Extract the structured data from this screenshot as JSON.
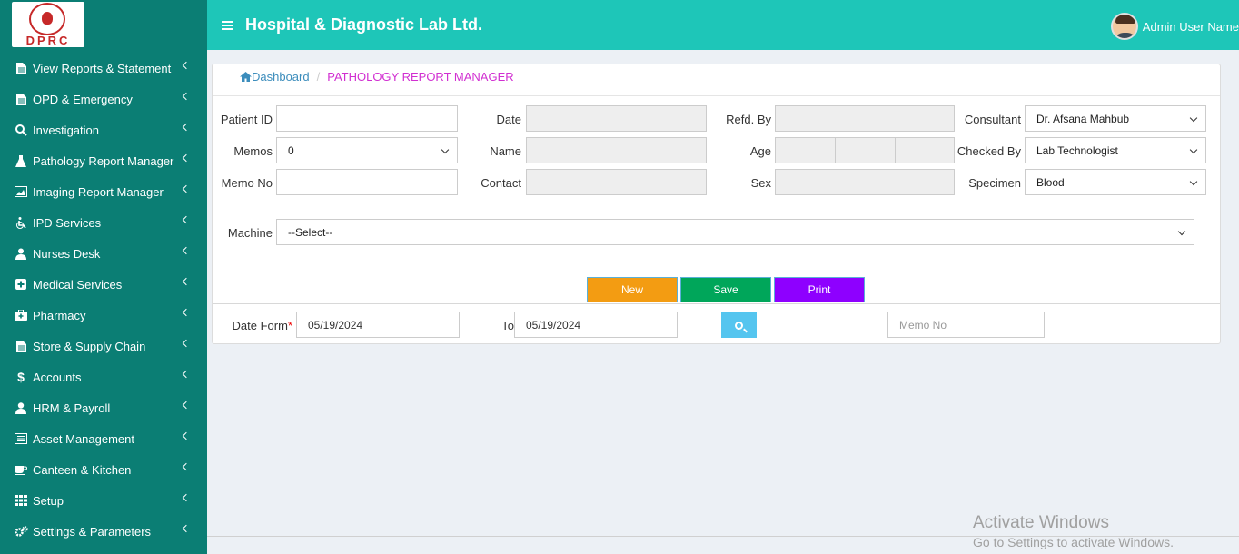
{
  "logo": {
    "text": "DPRC"
  },
  "header": {
    "title": "Hospital & Diagnostic Lab Ltd.",
    "user_name": "Admin User Name"
  },
  "sidebar": {
    "items": [
      {
        "label": "View Reports & Statement",
        "icon": "file-icon"
      },
      {
        "label": "OPD & Emergency",
        "icon": "file-icon"
      },
      {
        "label": "Investigation",
        "icon": "search-icon"
      },
      {
        "label": "Pathology Report Manager",
        "icon": "flask-icon"
      },
      {
        "label": "Imaging Report Manager",
        "icon": "image-icon"
      },
      {
        "label": "IPD Services",
        "icon": "wheelchair-icon"
      },
      {
        "label": "Nurses Desk",
        "icon": "user-md-icon"
      },
      {
        "label": "Medical Services",
        "icon": "plus-square-icon"
      },
      {
        "label": "Pharmacy",
        "icon": "medkit-icon"
      },
      {
        "label": "Store & Supply Chain",
        "icon": "file-icon"
      },
      {
        "label": "Accounts",
        "icon": "dollar-icon"
      },
      {
        "label": "HRM & Payroll",
        "icon": "user-icon"
      },
      {
        "label": "Asset Management",
        "icon": "list-icon"
      },
      {
        "label": "Canteen & Kitchen",
        "icon": "coffee-icon"
      },
      {
        "label": "Setup",
        "icon": "grid-icon"
      },
      {
        "label": "Settings & Parameters",
        "icon": "gears-icon"
      }
    ]
  },
  "breadcrumb": {
    "home": "Dashboard",
    "current": "PATHOLOGY REPORT MANAGER"
  },
  "form": {
    "patient_id_label": "Patient ID",
    "patient_id_value": "",
    "memos_label": "Memos",
    "memos_value": "0",
    "memo_no_label": "Memo No",
    "memo_no_value": "",
    "date_label": "Date",
    "name_label": "Name",
    "contact_label": "Contact",
    "refd_by_label": "Refd. By",
    "age_label": "Age",
    "sex_label": "Sex",
    "consultant_label": "Consultant",
    "consultant_value": "Dr. Afsana Mahbub",
    "checked_by_label": "Checked By",
    "checked_by_value": "Lab Technologist",
    "specimen_label": "Specimen",
    "specimen_value": "Blood",
    "machine_label": "Machine",
    "machine_value": "--Select--"
  },
  "actions": {
    "new": "New",
    "save": "Save",
    "print": "Print"
  },
  "filter": {
    "date_from_label": "Date Form",
    "required_mark": "*",
    "date_from_value": "05/19/2024",
    "to_label": "To",
    "to_value": "05/19/2024",
    "memo_no_placeholder": "Memo No"
  },
  "colors": {
    "sidebar": "#0b7e74",
    "topbar": "#1ec6b8",
    "new": "#f39c12",
    "save": "#00a65a",
    "print": "#8e00ff",
    "search": "#55c5ef"
  },
  "watermark": {
    "line1": "Activate Windows",
    "line2": "Go to Settings to activate Windows."
  }
}
